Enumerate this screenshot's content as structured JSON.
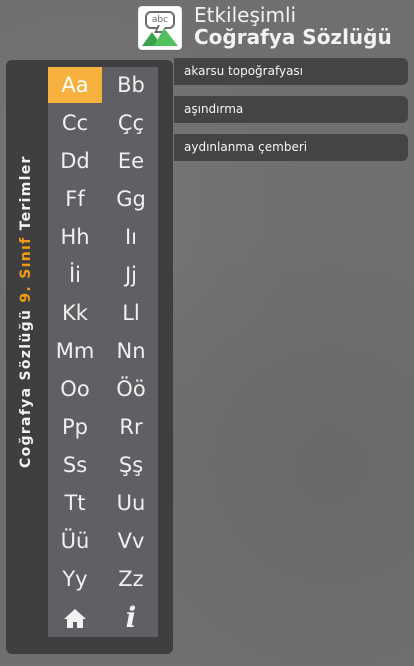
{
  "header": {
    "title_line1": "Etkileşimli",
    "title_line2": "Coğrafya Sözlüğü",
    "logo_text": "abc"
  },
  "sidebar": {
    "vertical_title_part1": "Coğrafya Sözlüğü ",
    "vertical_title_part2": "9. Sınıf",
    "vertical_title_part3": " Terimler",
    "accent_color": "#f39c12"
  },
  "letters": [
    "Aa",
    "Bb",
    "Cc",
    "Çç",
    "Dd",
    "Ee",
    "Ff",
    "Gg",
    "Hh",
    "Iı",
    "İi",
    "Jj",
    "Kk",
    "Ll",
    "Mm",
    "Nn",
    "Oo",
    "Öö",
    "Pp",
    "Rr",
    "Ss",
    "Şş",
    "Tt",
    "Uu",
    "Üü",
    "Vv",
    "Yy",
    "Zz"
  ],
  "selected_letter": "Aa",
  "icons": {
    "home": "home-icon",
    "info": "info-icon"
  },
  "terms": [
    "akarsu topoğrafyası",
    "aşındırma",
    "aydınlanma çemberi"
  ]
}
